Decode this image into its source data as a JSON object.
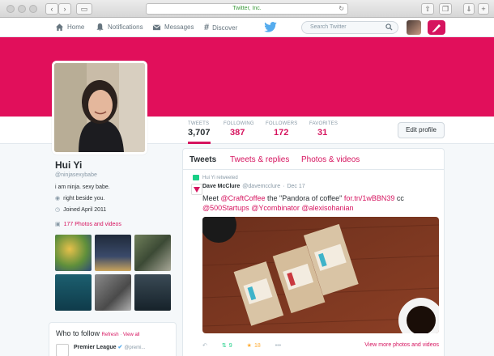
{
  "browser": {
    "url": "Twitter, Inc."
  },
  "topnav": {
    "home": "Home",
    "notifications": "Notifications",
    "messages": "Messages",
    "discover": "Discover",
    "search_placeholder": "Search Twitter"
  },
  "colors": {
    "accent": "#d6145f",
    "banner": "#e10f5b",
    "retweet": "#19cf86",
    "favorite": "#ffac33"
  },
  "stats": [
    {
      "label": "TWEETS",
      "value": "3,707"
    },
    {
      "label": "FOLLOWING",
      "value": "387"
    },
    {
      "label": "FOLLOWERS",
      "value": "172"
    },
    {
      "label": "FAVORITES",
      "value": "31"
    }
  ],
  "edit_profile": "Edit profile",
  "profile": {
    "name": "Hui Yi",
    "handle": "@ninjasexybabe",
    "bio": "i am ninja. sexy babe.",
    "location": "right beside you.",
    "joined": "Joined April 2011",
    "photos_link": "177 Photos and videos"
  },
  "who_to_follow": {
    "title": "Who to follow",
    "refresh": "Refresh",
    "sep": " · ",
    "view_all": "View all",
    "suggestion_name": "Premier League",
    "suggestion_handle": "@premi..."
  },
  "tabs": [
    "Tweets",
    "Tweets & replies",
    "Photos & videos"
  ],
  "tweet": {
    "retweeted_by": "Hui Yi retweeted",
    "author_name": "Dave McClure",
    "author_handle": "@davemcclure",
    "date": "Dec 17",
    "text_1": "Meet ",
    "mention_1": "@CraftCoffee",
    "text_2": " the \"Pandora of coffee\" ",
    "link": "for.tn/1wBBN39",
    "text_3": " cc",
    "mention_2": "@500Startups",
    "mention_3": "@Ycombinator",
    "mention_4": "@alexisohanian",
    "retweets": "9",
    "favorites": "18",
    "more": "•••",
    "view_more": "View more photos and videos"
  }
}
